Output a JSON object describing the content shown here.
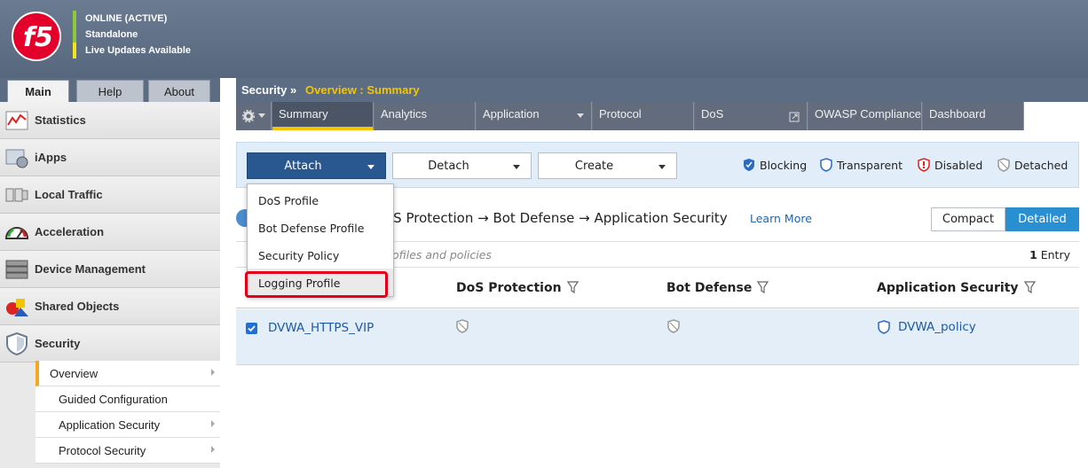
{
  "header": {
    "status": [
      {
        "text": "ONLINE (ACTIVE)"
      },
      {
        "text": "Standalone"
      },
      {
        "text": "Live Updates Available"
      }
    ]
  },
  "left_tabs": [
    "Main",
    "Help",
    "About"
  ],
  "sidebar": {
    "items": [
      {
        "label": "Statistics"
      },
      {
        "label": "iApps"
      },
      {
        "label": "Local Traffic"
      },
      {
        "label": "Acceleration"
      },
      {
        "label": "Device Management"
      },
      {
        "label": "Shared Objects"
      },
      {
        "label": "Security"
      }
    ],
    "sub_items": [
      {
        "label": "Overview"
      },
      {
        "label": "Guided Configuration"
      },
      {
        "label": "Application Security"
      },
      {
        "label": "Protocol Security"
      }
    ]
  },
  "breadcrumb": {
    "section": "Security",
    "separator": "»",
    "page": "Overview : Summary"
  },
  "menu_tabs": [
    "Summary",
    "Analytics",
    "Application",
    "Protocol",
    "DoS",
    "OWASP Compliance",
    "Dashboard"
  ],
  "toolbar": {
    "attach": "Attach",
    "detach": "Detach",
    "create": "Create"
  },
  "legend": [
    "Blocking",
    "Transparent",
    "Disabled",
    "Detached"
  ],
  "flow": {
    "text": "oS Protection → Bot Defense → Application Security",
    "learn_more": "Learn More"
  },
  "view": {
    "compact": "Compact",
    "detailed": "Detailed"
  },
  "filter": {
    "placeholder": "ofiles and policies",
    "count": "1",
    "count_label": " Entry"
  },
  "columns": [
    "DoS Protection",
    "Bot Defense",
    "Application Security"
  ],
  "rows": [
    {
      "name": "DVWA_HTTPS_VIP",
      "policy": "DVWA_policy"
    }
  ],
  "attach_menu": [
    "DoS Profile",
    "Bot Defense Profile",
    "Security Policy",
    "Logging Profile"
  ],
  "colors": {
    "accent": "#f5c400",
    "primary_button": "#28588f",
    "highlight": "#e2001a"
  }
}
